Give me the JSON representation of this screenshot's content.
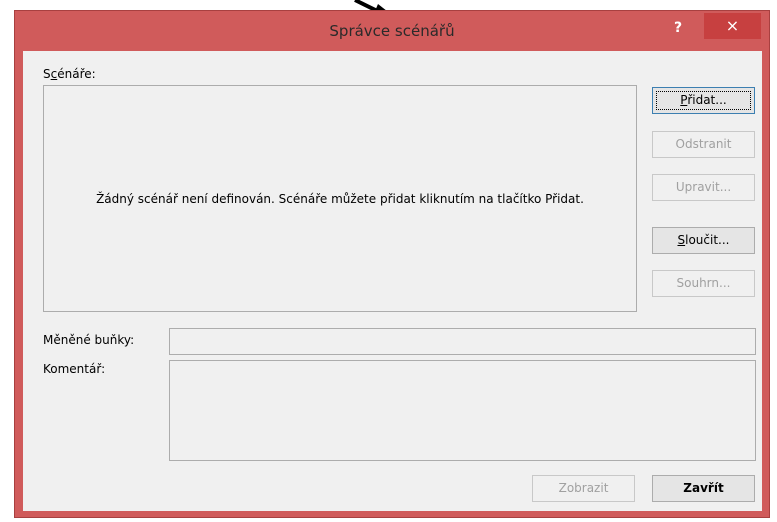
{
  "window": {
    "title": "Správce scénářů",
    "help_label": "?",
    "close_label": "×"
  },
  "scenarios": {
    "label_prefix": "S",
    "label_accel": "c",
    "label_rest": "énáře:",
    "empty_message": "Žádný scénář není definován. Scénáře můžete přidat kliknutím na tlačítko Přidat."
  },
  "buttons": {
    "add": {
      "accel": "P",
      "rest": "řidat..."
    },
    "delete": "Odstranit",
    "edit": "Upravit...",
    "merge": {
      "accel": "S",
      "rest": "loučit..."
    },
    "summary": "Souhrn...",
    "show": "Zobrazit",
    "close": "Zavřít"
  },
  "changing_cells": {
    "label": "Měněné buňky:",
    "value": ""
  },
  "comment": {
    "label": "Komentář:",
    "value": ""
  }
}
